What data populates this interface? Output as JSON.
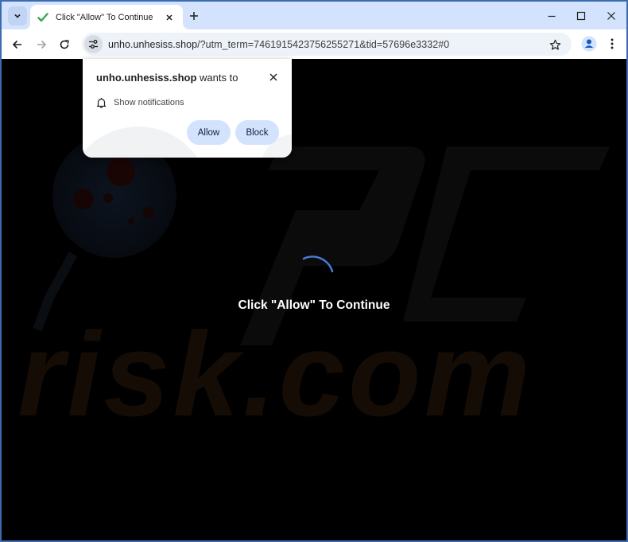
{
  "browser": {
    "tab": {
      "title": "Click \"Allow\" To Continue",
      "favicon": "checkmark-icon",
      "favicon_color": "#34a853"
    },
    "omnibox": {
      "host": "unho.unhesiss.shop",
      "path": "/?utm_term=7461915423756255271&tid=57696e3332#0"
    },
    "icons": {
      "tab_search": "chevron-down-icon",
      "tab_close": "close-icon",
      "new_tab": "plus-icon",
      "minimize": "minimize-icon",
      "maximize": "maximize-icon",
      "close_window": "close-icon",
      "back": "arrow-left-icon",
      "forward": "arrow-right-icon",
      "reload": "reload-icon",
      "site_info": "tune-icon",
      "bookmark": "star-icon",
      "profile": "person-icon",
      "menu": "kebab-menu-icon"
    }
  },
  "permission_popup": {
    "site": "unho.unhesiss.shop",
    "wants_to": "wants to",
    "permission_label": "Show notifications",
    "permission_icon": "bell-icon",
    "allow_label": "Allow",
    "block_label": "Block"
  },
  "page": {
    "message": "Click \"Allow\" To Continue",
    "spinner_color": "#4a7bd6",
    "watermark_text": "risk.com"
  },
  "colors": {
    "tabstrip_bg": "#d3e3fd",
    "window_border": "#3b6bb0",
    "page_bg": "#000000",
    "button_bg": "#d3e3fd"
  }
}
